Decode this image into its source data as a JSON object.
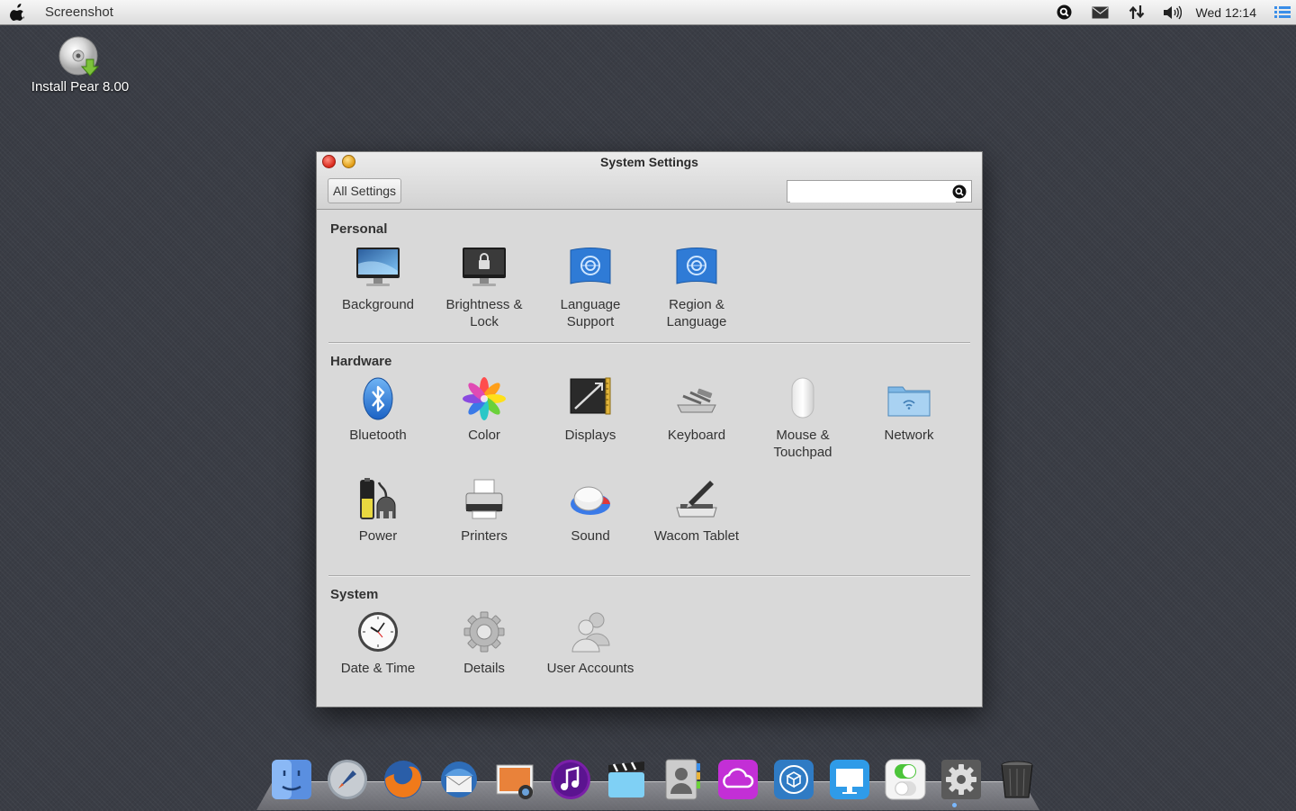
{
  "menubar": {
    "app_name": "Screenshot",
    "clock": "Wed 12:14",
    "icons": [
      "search-icon",
      "mail-icon",
      "network-arrows-icon",
      "volume-icon",
      "list-icon"
    ]
  },
  "desktop": {
    "icon_label": "Install Pear 8.00"
  },
  "window": {
    "title": "System Settings",
    "all_settings_label": "All Settings",
    "search_placeholder": "",
    "sections": {
      "personal": {
        "title": "Personal",
        "items": [
          "Background",
          "Brightness & Lock",
          "Language Support",
          "Region & Language"
        ]
      },
      "hardware": {
        "title": "Hardware",
        "items": [
          "Bluetooth",
          "Color",
          "Displays",
          "Keyboard",
          "Mouse & Touchpad",
          "Network",
          "Power",
          "Printers",
          "Sound",
          "Wacom Tablet"
        ]
      },
      "system": {
        "title": "System",
        "items": [
          "Date & Time",
          "Details",
          "User Accounts"
        ]
      }
    }
  },
  "dock": {
    "items": [
      "finder-icon",
      "launchpad-icon",
      "firefox-icon",
      "thunderbird-icon",
      "photos-icon",
      "music-icon",
      "video-icon",
      "contacts-icon",
      "cloud-icon",
      "app-store-icon",
      "screen-sharing-icon",
      "toggle-switches-icon",
      "system-settings-icon",
      "trash-icon"
    ]
  },
  "colors": {
    "accent": "#2f7bd6",
    "close": "#d8281b",
    "minimize": "#e09a12"
  }
}
